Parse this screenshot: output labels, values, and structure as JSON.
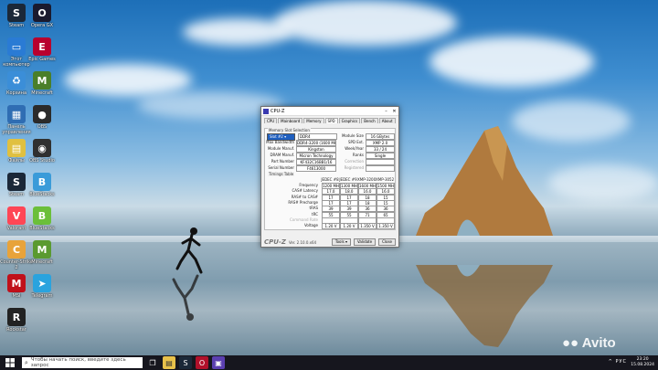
{
  "desktop_icons": [
    {
      "label": "Steam",
      "name": "desktop-icon-steam",
      "color": "#1b2838",
      "glyph": "S"
    },
    {
      "label": "Opera GX",
      "name": "desktop-icon-opera-gx",
      "color": "#1a1a2e",
      "glyph": "O"
    },
    {
      "label": "Этот компьютер",
      "name": "desktop-icon-this-pc",
      "color": "#2a7bd4",
      "glyph": "▭"
    },
    {
      "label": "Epic Games",
      "name": "desktop-icon-epic",
      "color": "#b8002e",
      "glyph": "E"
    },
    {
      "label": "Корзина",
      "name": "desktop-icon-recycle-bin",
      "color": "#3b8ed8",
      "glyph": "♻"
    },
    {
      "label": "Minecraft",
      "name": "desktop-icon-minecraft",
      "color": "#4a7f2a",
      "glyph": "M"
    },
    {
      "label": "Панель управления",
      "name": "desktop-icon-control-panel",
      "color": "#2f6db3",
      "glyph": "▦"
    },
    {
      "label": "OBS",
      "name": "desktop-icon-obs",
      "color": "#2b2b2b",
      "glyph": "●"
    },
    {
      "label": "Файлы",
      "name": "desktop-icon-files",
      "color": "#e0c040",
      "glyph": "▤"
    },
    {
      "label": "OBS Studio",
      "name": "desktop-icon-obs-studio",
      "color": "#303030",
      "glyph": "◉"
    },
    {
      "label": "Steam",
      "name": "desktop-icon-steam-2",
      "color": "#1b2838",
      "glyph": "S"
    },
    {
      "label": "BlueStacks",
      "name": "desktop-icon-bluestacks",
      "color": "#3a9bd9",
      "glyph": "B"
    },
    {
      "label": "Valorant",
      "name": "desktop-icon-valorant",
      "color": "#ff4655",
      "glyph": "V"
    },
    {
      "label": "BlueStacks",
      "name": "desktop-icon-bluestacks-2",
      "color": "#6bbf3a",
      "glyph": "B"
    },
    {
      "label": "Counter-Strike 2",
      "name": "desktop-icon-cs2",
      "color": "#e8a33a",
      "glyph": "C"
    },
    {
      "label": "Minecraft",
      "name": "desktop-icon-minecraft-2",
      "color": "#5a9a30",
      "glyph": "M"
    },
    {
      "label": "MSI",
      "name": "desktop-icon-msi",
      "color": "#c0101a",
      "glyph": "M"
    },
    {
      "label": "Telegram",
      "name": "desktop-icon-telegram",
      "color": "#2aa3de",
      "glyph": "➤"
    },
    {
      "label": "Rockstar",
      "name": "desktop-icon-rockstar",
      "color": "#222222",
      "glyph": "R"
    }
  ],
  "cpuz": {
    "title": "CPU-Z",
    "tabs": [
      "CPU",
      "Mainboard",
      "Memory",
      "SPD",
      "Graphics",
      "Bench",
      "About"
    ],
    "active_tab": "SPD",
    "slot_group": "Memory Slot Selection",
    "slot": "Slot #2",
    "type": "DDR4",
    "module_size_label": "Module Size",
    "module_size": "16 GBytes",
    "max_bw_label": "Max Bandwidth",
    "max_bw": "DDR4-3200 (1600 MHz)",
    "spd_ext_label": "SPD Ext.",
    "spd_ext": "XMP 2.0",
    "manuf_label": "Module Manuf.",
    "manuf": "Kingston",
    "week_year_label": "Week/Year",
    "week_year": "33 / 24",
    "dram_label": "DRAM Manuf.",
    "dram": "Micron Technology",
    "ranks_label": "Ranks",
    "ranks": "Single",
    "part_label": "Part Number",
    "part": "KF432C16BB1/16",
    "correction_label": "Correction",
    "serial_label": "Serial Number",
    "serial": "F4613000",
    "registered_label": "Registered",
    "timings_group": "Timings Table",
    "timing_headers": [
      "JEDEC #8",
      "JEDEC #9",
      "XMP-3200",
      "XMP-3052"
    ],
    "timing_rows": [
      {
        "label": "Frequency",
        "values": [
          "1200 MHz",
          "1300 MHz",
          "1600 MHz",
          "1500 MHz"
        ]
      },
      {
        "label": "CAS# Latency",
        "values": [
          "17.0",
          "18.0",
          "16.0",
          "16.0"
        ]
      },
      {
        "label": "RAS# to CAS#",
        "values": [
          "17",
          "17",
          "18",
          "15"
        ]
      },
      {
        "label": "RAS# Precharge",
        "values": [
          "17",
          "17",
          "18",
          "15"
        ]
      },
      {
        "label": "tRAS",
        "values": [
          "39",
          "39",
          "36",
          "36"
        ]
      },
      {
        "label": "tRC",
        "values": [
          "55",
          "55",
          "71",
          "65"
        ]
      },
      {
        "label": "Command Rate",
        "values": [
          "",
          "",
          "",
          ""
        ]
      },
      {
        "label": "Voltage",
        "values": [
          "1.20 V",
          "1.20 V",
          "1.350 V",
          "1.350 V"
        ]
      }
    ],
    "brand": "CPU-Z",
    "version": "Ver. 2.10.0.x64",
    "tools_label": "Tools",
    "validate_label": "Validate",
    "close_label": "Close"
  },
  "taskbar": {
    "search_placeholder": "Чтобы начать поиск, введите здесь запрос",
    "time": "23:20",
    "date": "15.08.2024",
    "lang": "РУС"
  },
  "watermark": "Avito"
}
